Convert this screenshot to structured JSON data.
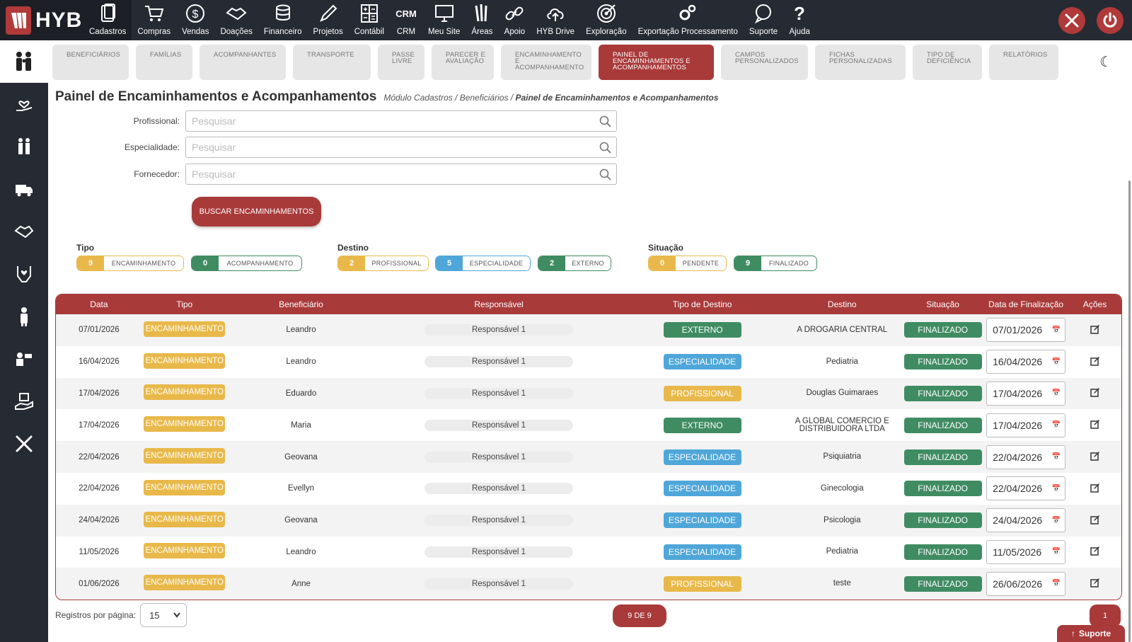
{
  "brand": "HYB",
  "topnav": [
    {
      "label": "Cadastros",
      "icon": "document-icon",
      "active": true
    },
    {
      "label": "Compras",
      "icon": "cart-icon"
    },
    {
      "label": "Vendas",
      "icon": "dollar-icon"
    },
    {
      "label": "Doações",
      "icon": "handshake-icon"
    },
    {
      "label": "Financeiro",
      "icon": "coins-icon"
    },
    {
      "label": "Projetos",
      "icon": "pencil-icon"
    },
    {
      "label": "Contábil",
      "icon": "calculator-icon"
    },
    {
      "label": "CRM",
      "icon": "crm-icon"
    },
    {
      "label": "Meu Site",
      "icon": "monitor-icon"
    },
    {
      "label": "Áreas",
      "icon": "tools-icon"
    },
    {
      "label": "Apoio",
      "icon": "link-icon"
    },
    {
      "label": "HYB Drive",
      "icon": "cloud-upload-icon"
    },
    {
      "label": "Exploração",
      "icon": "target-icon"
    },
    {
      "label": "Exportação Processamento",
      "icon": "gears-icon"
    },
    {
      "label": "Suporte",
      "icon": "chat-icon"
    },
    {
      "label": "Ajuda",
      "icon": "question-icon"
    }
  ],
  "subtabs": [
    "BENEFICIÁRIOS",
    "FAMÍLIAS",
    "ACOMPANHANTES",
    "TRANSPORTE",
    "PASSE LIVRE",
    "PARECER E AVALIAÇÃO",
    "ENCAMINHAMENTO E ACOMPANHAMENTO",
    "PAINEL DE ENCAMINHAMENTOS E ACOMPANHAMENTOS",
    "CAMPOS PERSONALIZADOS",
    "FICHAS PERSONALIZADAS",
    "TIPO DE DEFICIÊNCIA",
    "RELATÓRIOS"
  ],
  "page": {
    "title": "Painel de Encaminhamentos e Acompanhamentos",
    "breadcrumb_prefix": "Módulo Cadastros / Beneficiários / ",
    "breadcrumb_current": "Painel de Encaminhamentos e Acompanhamentos"
  },
  "filters": {
    "profissional_label": "Profissional:",
    "especialidade_label": "Especialidade:",
    "fornecedor_label": "Fornecedor:",
    "placeholder": "Pesquisar",
    "search_button": "BUSCAR ENCAMINHAMENTOS"
  },
  "summary": {
    "tipo": {
      "label": "Tipo",
      "items": [
        {
          "count": "9",
          "label": "ENCAMINHAMENTO"
        },
        {
          "count": "0",
          "label": "ACOMPANHAMENTO"
        }
      ]
    },
    "destino": {
      "label": "Destino",
      "items": [
        {
          "count": "2",
          "label": "PROFISSIONAL"
        },
        {
          "count": "5",
          "label": "ESPECIALIDADE"
        },
        {
          "count": "2",
          "label": "EXTERNO"
        }
      ]
    },
    "situacao": {
      "label": "Situação",
      "items": [
        {
          "count": "0",
          "label": "PENDENTE"
        },
        {
          "count": "9",
          "label": "FINALIZADO"
        }
      ]
    }
  },
  "table": {
    "headers": [
      "Data",
      "Tipo",
      "Beneficiário",
      "Responsável",
      "Tipo de Destino",
      "Destino",
      "Situação",
      "Data de Finalização",
      "Ações"
    ],
    "rows": [
      {
        "data": "07/01/2026",
        "tipo": "ENCAMINHAMENTO",
        "beneficiario": "Leandro",
        "responsavel": "Responsável 1",
        "tipo_destino": "EXTERNO",
        "destino": "A DROGARIA CENTRAL",
        "situacao": "FINALIZADO",
        "finalizacao": "07/01/2026"
      },
      {
        "data": "16/04/2026",
        "tipo": "ENCAMINHAMENTO",
        "beneficiario": "Leandro",
        "responsavel": "Responsável 1",
        "tipo_destino": "ESPECIALIDADE",
        "destino": "Pediatria",
        "situacao": "FINALIZADO",
        "finalizacao": "16/04/2026"
      },
      {
        "data": "17/04/2026",
        "tipo": "ENCAMINHAMENTO",
        "beneficiario": "Eduardo",
        "responsavel": "Responsável 1",
        "tipo_destino": "PROFISSIONAL",
        "destino": "Douglas Guimaraes",
        "situacao": "FINALIZADO",
        "finalizacao": "17/04/2026"
      },
      {
        "data": "17/04/2026",
        "tipo": "ENCAMINHAMENTO",
        "beneficiario": "Maria",
        "responsavel": "Responsável 1",
        "tipo_destino": "EXTERNO",
        "destino": "A GLOBAL COMERCIO E DISTRIBUIDORA LTDA",
        "situacao": "FINALIZADO",
        "finalizacao": "17/04/2026"
      },
      {
        "data": "22/04/2026",
        "tipo": "ENCAMINHAMENTO",
        "beneficiario": "Geovana",
        "responsavel": "Responsável 1",
        "tipo_destino": "ESPECIALIDADE",
        "destino": "Psiquiatria",
        "situacao": "FINALIZADO",
        "finalizacao": "22/04/2026"
      },
      {
        "data": "22/04/2026",
        "tipo": "ENCAMINHAMENTO",
        "beneficiario": "Evellyn",
        "responsavel": "Responsável 1",
        "tipo_destino": "ESPECIALIDADE",
        "destino": "Ginecologia",
        "situacao": "FINALIZADO",
        "finalizacao": "22/04/2026"
      },
      {
        "data": "24/04/2026",
        "tipo": "ENCAMINHAMENTO",
        "beneficiario": "Geovana",
        "responsavel": "Responsável 1",
        "tipo_destino": "ESPECIALIDADE",
        "destino": "Psicologia",
        "situacao": "FINALIZADO",
        "finalizacao": "24/04/2026"
      },
      {
        "data": "11/05/2026",
        "tipo": "ENCAMINHAMENTO",
        "beneficiario": "Leandro",
        "responsavel": "Responsável 1",
        "tipo_destino": "ESPECIALIDADE",
        "destino": "Pediatria",
        "situacao": "FINALIZADO",
        "finalizacao": "11/05/2026"
      },
      {
        "data": "01/06/2026",
        "tipo": "ENCAMINHAMENTO",
        "beneficiario": "Anne",
        "responsavel": "Responsável 1",
        "tipo_destino": "PROFISSIONAL",
        "destino": "teste",
        "situacao": "FINALIZADO",
        "finalizacao": "26/06/2026"
      }
    ]
  },
  "footer": {
    "per_page_label": "Registros por página:",
    "per_page_value": "15",
    "pager_text": "9 DE 9",
    "page_number": "1",
    "support_label": "Suporte"
  },
  "colors": {
    "primary": "#a93a3a",
    "nav_bg": "#262a33",
    "encaminhamento": "#e8b94a",
    "externo": "#3f8c62",
    "especialidade": "#4fa6d9",
    "profissional": "#e8b94a",
    "finalizado": "#3f8c62"
  }
}
